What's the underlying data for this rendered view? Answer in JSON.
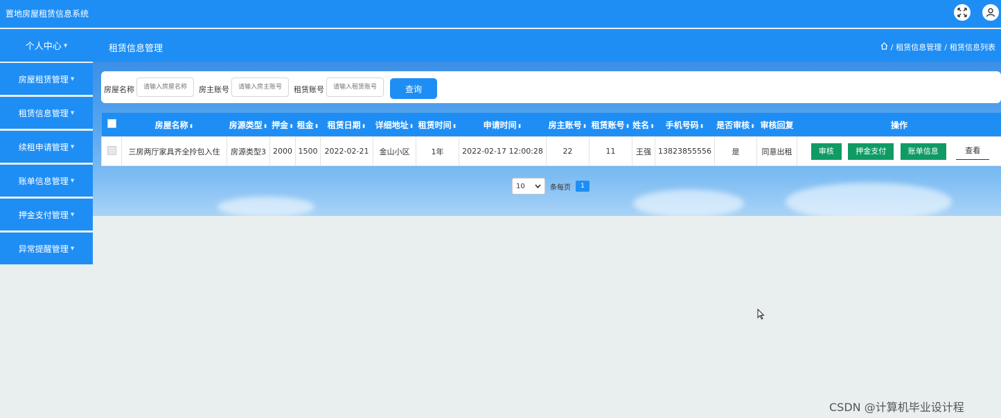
{
  "app": {
    "title": "置地房屋租赁信息系统"
  },
  "header": {
    "expand_icon": "expand-icon",
    "user_icon": "user-icon"
  },
  "nav": {
    "personal_center": "个人中心",
    "section_title": "租赁信息管理"
  },
  "breadcrumb": {
    "home_icon": "home-icon",
    "sep": "/",
    "items": [
      "租赁信息管理",
      "租赁信息列表"
    ]
  },
  "sidebar": {
    "items": [
      {
        "label": "房屋租赁管理"
      },
      {
        "label": "租赁信息管理"
      },
      {
        "label": "续租申请管理"
      },
      {
        "label": "账单信息管理"
      },
      {
        "label": "押金支付管理"
      },
      {
        "label": "异常提醒管理"
      }
    ]
  },
  "search": {
    "house_name_label": "房屋名称",
    "house_name_placeholder": "请输入房屋名称",
    "owner_label": "房主账号",
    "owner_placeholder": "请输入房主账号",
    "renter_label": "租赁账号",
    "renter_placeholder": "请输入租赁账号",
    "button": "查询"
  },
  "table": {
    "columns": [
      "房屋名称",
      "房源类型",
      "押金",
      "租金",
      "租赁日期",
      "详细地址",
      "租赁时间",
      "申请时间",
      "房主账号",
      "租赁账号",
      "姓名",
      "手机号码",
      "是否审核",
      "审核回复",
      "操作"
    ],
    "rows": [
      {
        "cells": [
          "三房两厅家具齐全拎包入住",
          "房源类型3",
          "2000",
          "1500",
          "2022-02-21",
          "金山小区",
          "1年",
          "2022-02-17 12:00:28",
          "22",
          "11",
          "王强",
          "13823855556",
          "是",
          "同意出租"
        ]
      }
    ],
    "actions": {
      "review": "审核",
      "deposit": "押金支付",
      "bill": "账单信息",
      "view": "查看"
    }
  },
  "pager": {
    "page_size": "10",
    "per_page_label": "条每页",
    "current_page": "1"
  },
  "watermark": "CSDN @计算机毕业设计程",
  "colors": {
    "primary": "#1e8ef5",
    "action_green": "#0f9b63",
    "page_bg": "#e8efee"
  }
}
